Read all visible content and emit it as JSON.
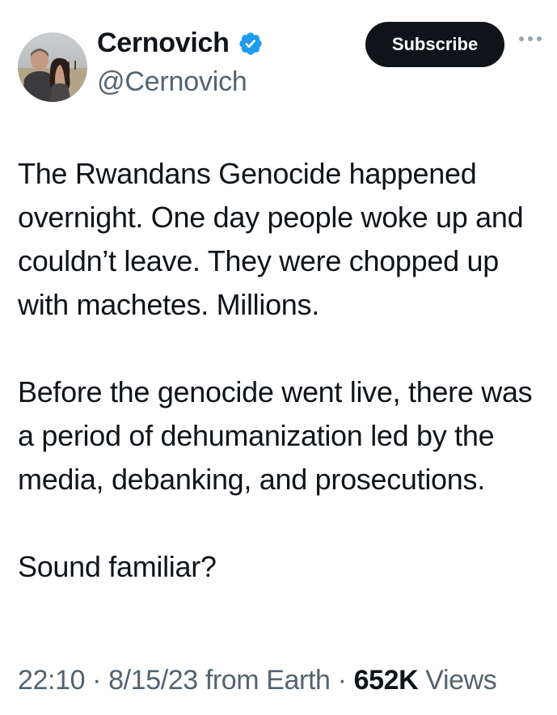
{
  "user": {
    "display_name": "Cernovich",
    "handle": "@Cernovich",
    "verified_icon": "verified-badge-icon",
    "avatar_icon": "profile-photo"
  },
  "actions": {
    "subscribe_label": "Subscribe",
    "more_icon": "more-options-icon"
  },
  "tweet": {
    "paragraphs": [
      "The Rwandans Genocide happened overnight. One day people woke up and couldn’t leave. They were chopped up with machetes. Millions.",
      "Before the genocide went live, there was a period of dehumanization led by the media, debanking, and prosecutions.",
      "Sound familiar?"
    ]
  },
  "meta": {
    "time": "22:10",
    "date": "8/15/23",
    "source": "from Earth",
    "separator": "·",
    "views_count": "652K",
    "views_label": "Views"
  },
  "colors": {
    "text": "#0f1419",
    "secondary": "#536471",
    "verified": "#1d9bf0",
    "button_bg": "#0f1419"
  }
}
